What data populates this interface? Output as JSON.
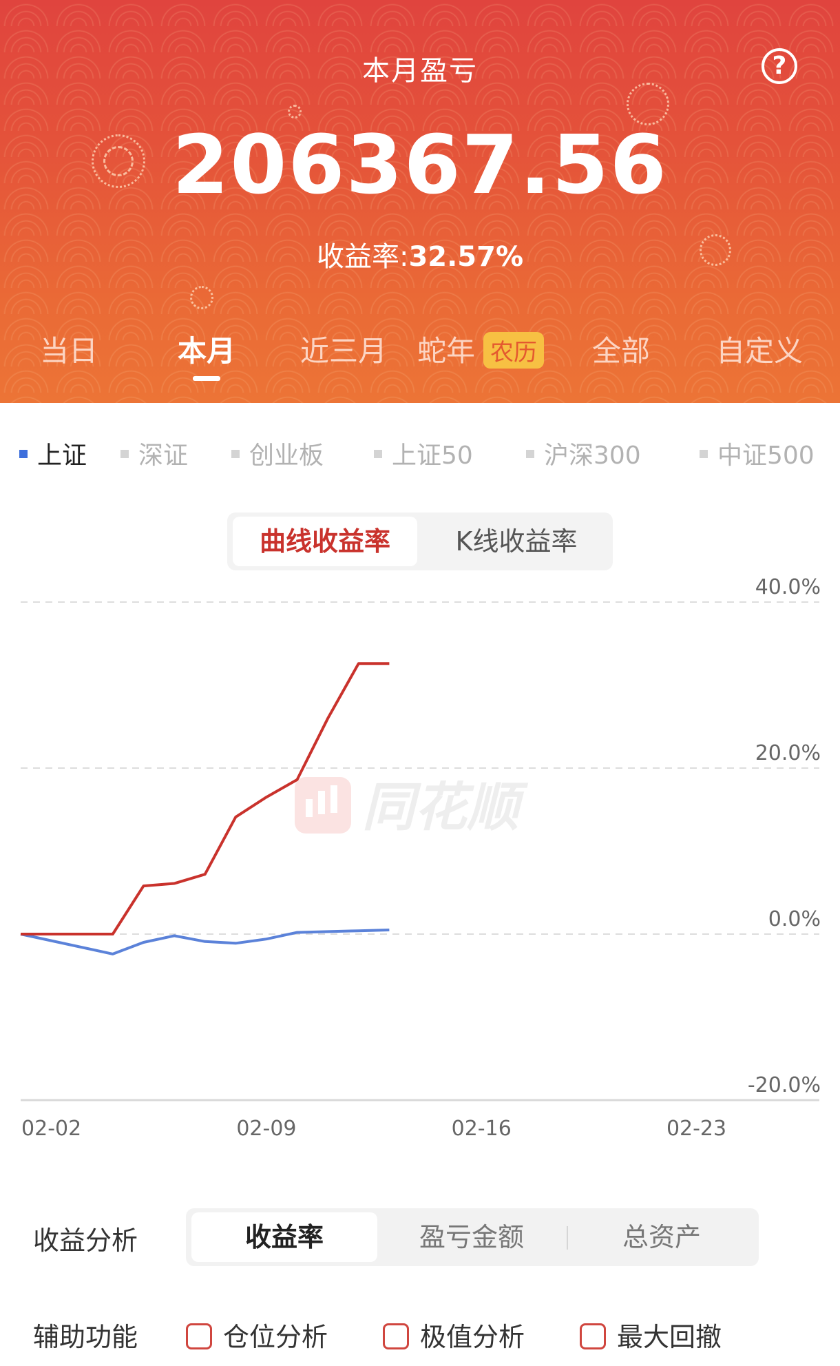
{
  "header": {
    "title": "本月盈亏",
    "help_icon": "?",
    "amount": "206367.56",
    "rate_label": "收益率:",
    "rate_value": "32.57%"
  },
  "period_tabs": [
    {
      "label": "当日",
      "active": false
    },
    {
      "label": "本月",
      "active": true
    },
    {
      "label": "近三月",
      "active": false
    },
    {
      "label": "蛇年",
      "badge": "农历",
      "active": false
    },
    {
      "label": "全部",
      "active": false
    },
    {
      "label": "自定义",
      "active": false
    }
  ],
  "index_tabs": [
    {
      "label": "上证",
      "active": true
    },
    {
      "label": "深证",
      "active": false
    },
    {
      "label": "创业板",
      "active": false
    },
    {
      "label": "上证50",
      "active": false
    },
    {
      "label": "沪深300",
      "active": false
    },
    {
      "label": "中证500",
      "active": false
    }
  ],
  "chart_modes": {
    "active": "曲线收益率",
    "inactive": "K线收益率"
  },
  "watermark": "同花顺",
  "colors": {
    "header_red": "#e0443e",
    "header_orange": "#ec7436",
    "portfolio_line": "#c9322c",
    "index_line": "#5b82d9",
    "badge_yellow": "#f7c043"
  },
  "chart_data": {
    "type": "line",
    "x_ticks": [
      "02-02",
      "02-09",
      "02-16",
      "02-23"
    ],
    "y_ticks": [
      "40.0%",
      "20.0%",
      "0.0%",
      "-20.0%"
    ],
    "ylim": [
      -20,
      40
    ],
    "x_unit": "day_of_month",
    "xlim": [
      1,
      27
    ],
    "grid": true,
    "series": [
      {
        "name": "portfolio",
        "color": "#c9322c",
        "x": [
          1,
          4,
          5,
          6,
          7,
          8,
          9,
          10,
          11,
          12,
          13
        ],
        "y": [
          0.0,
          0.0,
          5.8,
          6.1,
          7.2,
          14.1,
          16.5,
          18.6,
          26.0,
          32.6,
          32.6
        ]
      },
      {
        "name": "上证",
        "color": "#5b82d9",
        "x": [
          1,
          4,
          5,
          6,
          7,
          8,
          9,
          10,
          11,
          12,
          13
        ],
        "y": [
          0.0,
          -2.4,
          -1.0,
          -0.2,
          -0.9,
          -1.1,
          -0.6,
          0.2,
          0.3,
          0.4,
          0.5
        ]
      }
    ]
  },
  "analysis": {
    "label": "收益分析",
    "options": [
      "收益率",
      "盈亏金额",
      "总资产"
    ],
    "active": 0
  },
  "aux": {
    "label": "辅助功能",
    "options": [
      "仓位分析",
      "极值分析",
      "最大回撤"
    ]
  }
}
